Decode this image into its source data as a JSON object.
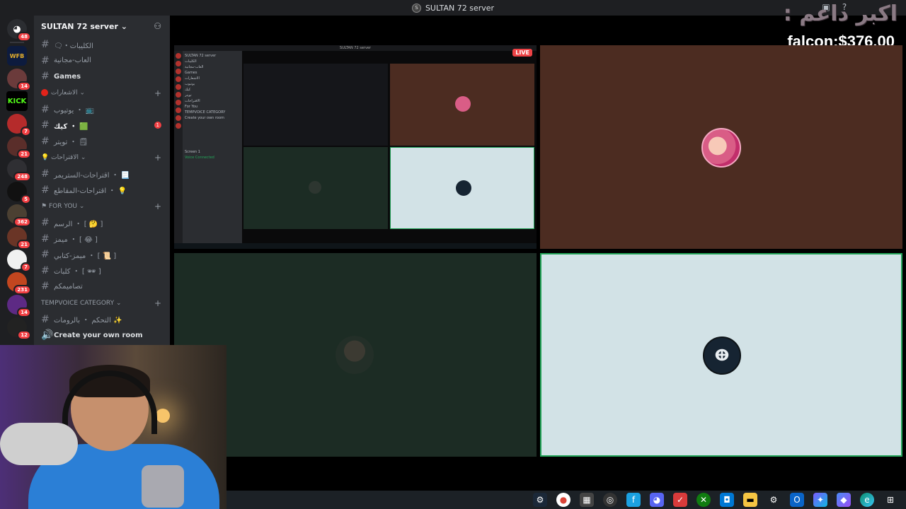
{
  "window": {
    "title": "SULTAN 72 server",
    "server_icon_text": "S"
  },
  "overlay": {
    "arabic_text": "اكبر داعم :",
    "price_text": "falcon:$376.00"
  },
  "rail": {
    "servers": [
      {
        "name": "discord-home",
        "label": "",
        "badge": "48"
      },
      {
        "name": "server-wfb",
        "label": "WFB",
        "badge": ""
      },
      {
        "name": "server-2",
        "label": "",
        "badge": "14"
      },
      {
        "name": "server-kick",
        "label": "KICK",
        "badge": ""
      },
      {
        "name": "server-4",
        "label": "",
        "badge": "7"
      },
      {
        "name": "server-5",
        "label": "",
        "badge": "21"
      },
      {
        "name": "server-6",
        "label": "",
        "badge": "248"
      },
      {
        "name": "server-7",
        "label": "",
        "badge": "5"
      },
      {
        "name": "server-8",
        "label": "",
        "badge": "362"
      },
      {
        "name": "server-9",
        "label": "",
        "badge": "21"
      },
      {
        "name": "server-10",
        "label": "",
        "badge": "7"
      },
      {
        "name": "server-11",
        "label": "",
        "badge": "231"
      },
      {
        "name": "server-12",
        "label": "",
        "badge": "14"
      },
      {
        "name": "server-13",
        "label": "",
        "badge": "12"
      }
    ]
  },
  "sidebar": {
    "server_name": "SULTAN 72 server",
    "channels_top": [
      {
        "label": "🗨・الكليبات"
      },
      {
        "label": "العاب-مجانية"
      },
      {
        "label": "Games"
      }
    ],
    "cat_notifications": "الاشعارات",
    "notif_channels": [
      {
        "label": "يوتيوب ・ 📺"
      },
      {
        "label": "كيك ・ 🟩",
        "badge": "1"
      },
      {
        "label": "تويتر ・ 🗒"
      }
    ],
    "cat_suggestions": "الاقتراحات",
    "suggest_channels": [
      {
        "label": "اقتراحات-الستريمر ・ 📃"
      },
      {
        "label": "اقتراحات-المقاطع ・ 💡"
      }
    ],
    "cat_foryou": "For You",
    "foryou_channels": [
      {
        "label": "الرسم ・ [ 🤔 ]"
      },
      {
        "label": "ميمز ・ [ 😂 ]"
      },
      {
        "label": "ميمز-كتابي ・ [ 📜 ]"
      },
      {
        "label": "كلبات ・ [ 🕶 ]"
      },
      {
        "label": "تصاميمكم"
      }
    ],
    "cat_tempvoice": "TEMPVOICE CATEGORY",
    "tempvoice_channels": [
      {
        "label": "التحكم ・ بالرومات ✨"
      },
      {
        "label": "Create your own room"
      }
    ]
  },
  "stage": {
    "live_badge": "LIVE",
    "logo_text": "ⴲ"
  },
  "mini": {
    "title": "SULTAN 72 server",
    "sidebar_lines": [
      "SULTAN 72 server",
      "الكليبات",
      "العاب-مجانية",
      "Games",
      "الاشعارات",
      "يوتيوب",
      "كيك",
      "تويتر",
      "الاقتراحات",
      "For You",
      "TEMPVOICE CATEGORY",
      "Create your own room",
      "Screen 1",
      "Voice Connected"
    ]
  },
  "taskbar": {
    "icons": [
      "steam-icon",
      "chrome-icon",
      "store-icon",
      "obs-icon",
      "app-f-icon",
      "discord-icon",
      "app-red-icon",
      "xbox-icon",
      "app-blue-icon",
      "folder-icon",
      "settings-icon",
      "outlook-icon",
      "copilot-icon",
      "app-teal-icon",
      "edge-icon",
      "windows-icon"
    ]
  },
  "colors": {
    "speaking_border": "#23a559",
    "live_red": "#ed4245",
    "badge_red": "#f23f43"
  }
}
